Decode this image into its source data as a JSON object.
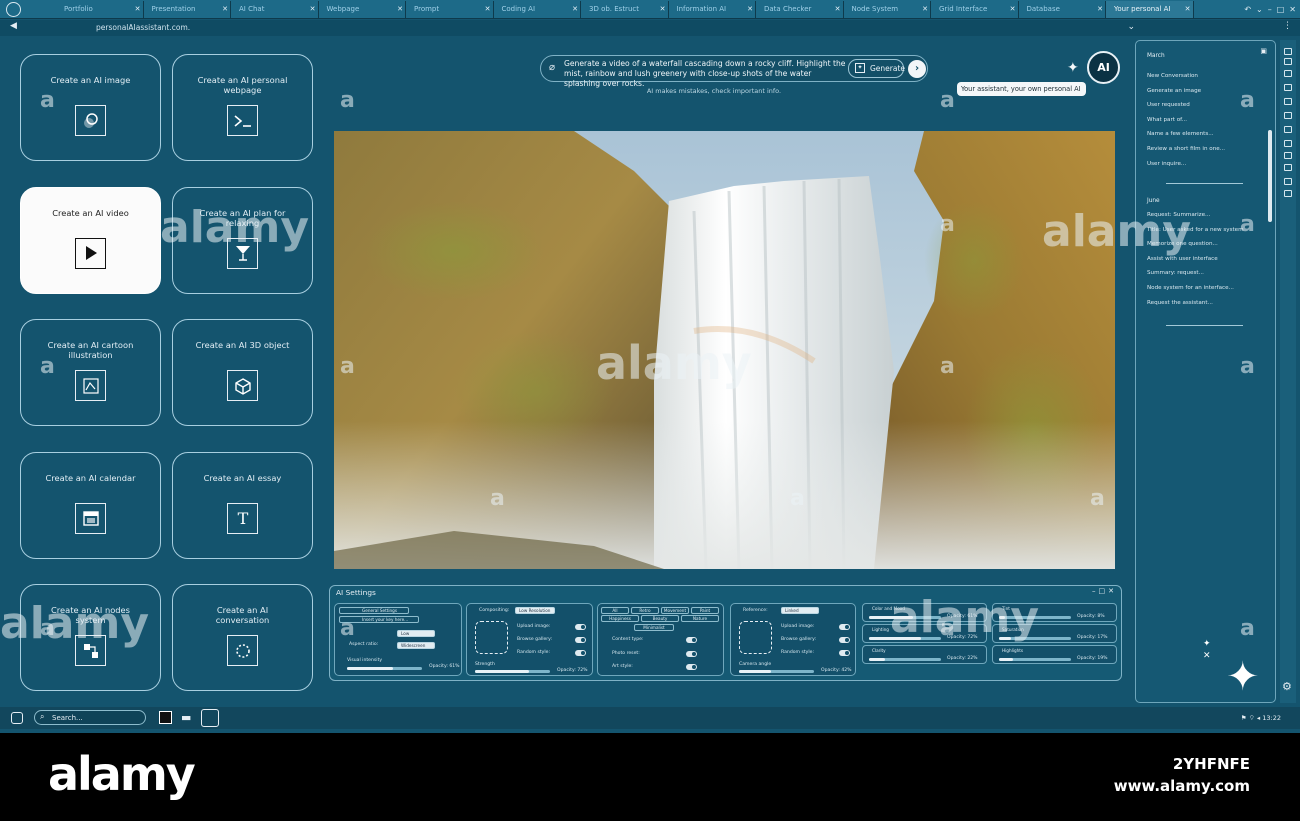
{
  "browser": {
    "tabs": [
      {
        "label": "Portfolio"
      },
      {
        "label": "Presentation"
      },
      {
        "label": "AI Chat"
      },
      {
        "label": "Webpage"
      },
      {
        "label": "Prompt"
      },
      {
        "label": "Coding AI"
      },
      {
        "label": "3D ob. Estruct"
      },
      {
        "label": "Information AI"
      },
      {
        "label": "Data Checker"
      },
      {
        "label": "Node System"
      },
      {
        "label": "Grid Interface"
      },
      {
        "label": "Database"
      },
      {
        "label": "Your personal AI"
      }
    ],
    "url": "personalAIassistant.com."
  },
  "tools": [
    {
      "label": "Create an AI image",
      "icon": "image-search-icon"
    },
    {
      "label": "Create an AI personal webpage",
      "icon": "terminal-icon"
    },
    {
      "label": "Create an AI video",
      "icon": "play-icon",
      "selected": true
    },
    {
      "label": "Create an AI plan for relaxing",
      "icon": "cocktail-icon"
    },
    {
      "label": "Create an AI cartoon illustration",
      "icon": "illustration-icon"
    },
    {
      "label": "Create an AI 3D object",
      "icon": "cube-icon"
    },
    {
      "label": "Create an AI calendar",
      "icon": "calendar-icon"
    },
    {
      "label": "Create an AI essay",
      "icon": "text-icon"
    },
    {
      "label": "Create an AI nodes system",
      "icon": "nodes-icon"
    },
    {
      "label": "Create an AI conversation",
      "icon": "conversation-icon"
    }
  ],
  "prompt": {
    "text": "Generate a video of a waterfall cascading down a rocky cliff. Highlight the mist, rainbow and lush greenery with close-up shots of the water splashing over rocks.",
    "generate_label": "Generate",
    "disclaimer": "AI makes mistakes, check important info."
  },
  "assistant": {
    "avatar_text": "AI",
    "tooltip": "Your assistant, your own personal AI"
  },
  "settings": {
    "title": "AI Settings",
    "p1": {
      "tab1": "General Settings",
      "tab2": "Insert your key here...",
      "dd1": "Low",
      "aspect_label": "Aspect ratio:",
      "aspect_value": "Widescreen",
      "intensity_label": "Visual intensity",
      "opacity": "Opacity: 61%",
      "intensity": 0.61
    },
    "p2": {
      "comp_label": "Compositing:",
      "comp_value": "Low Resolution",
      "upload": "Upload image:",
      "browse": "Browse gallery:",
      "random": "Random style:",
      "strength_label": "Strength",
      "opacity": "Opacity: 72%",
      "strength": 0.72
    },
    "p3": {
      "chips_row1": [
        "All",
        "Retro",
        "Movement",
        "Paint"
      ],
      "chips_row2": [
        "Happiness",
        "Beauty",
        "Nature"
      ],
      "chip_row3": "Minimalist",
      "content": "Content type:",
      "photo": "Photo reset:",
      "art": "Art style:"
    },
    "p4": {
      "ref_label": "Reference:",
      "ref_value": "Linked",
      "upload": "Upload image:",
      "browse": "Browse gallery:",
      "random": "Random style:",
      "camera_label": "Camera angle",
      "opacity": "Opacity: 42%",
      "camera": 0.42
    },
    "p5": {
      "rows": [
        {
          "label": "Color and Mood",
          "opacity": "Opacity: 61%",
          "value": 0.61
        },
        {
          "label": "Lighting",
          "opacity": "Opacity: 72%",
          "value": 0.72
        },
        {
          "label": "Clarity",
          "opacity": "Opacity: 22%",
          "value": 0.22
        }
      ]
    },
    "p6": {
      "rows": [
        {
          "label": "Tint",
          "opacity": "Opacity: 8%",
          "value": 0.08
        },
        {
          "label": "Saturation",
          "opacity": "Opacity: 17%",
          "value": 0.17
        },
        {
          "label": "Highlights",
          "opacity": "Opacity: 19%",
          "value": 0.19
        }
      ]
    }
  },
  "history": {
    "march_label": "March",
    "march": [
      "New Conversation",
      "Generate an image",
      "User requested",
      "What part of...",
      "Name a few elements...",
      "Review a short film in one...",
      "User inquire..."
    ],
    "june_label": "June",
    "june": [
      "Request: Summarize...",
      "Title: User asked for a new system",
      "Memorize one question...",
      "Assist with user interface",
      "Summary: request...",
      "Node system for an interface...",
      "Request the assistant..."
    ]
  },
  "taskbar": {
    "search_placeholder": "Search...",
    "time": "13:22"
  },
  "watermark": {
    "brand": "alamy",
    "letter": "a",
    "stock_id": "2YHFNFE",
    "site": "www.alamy.com"
  }
}
